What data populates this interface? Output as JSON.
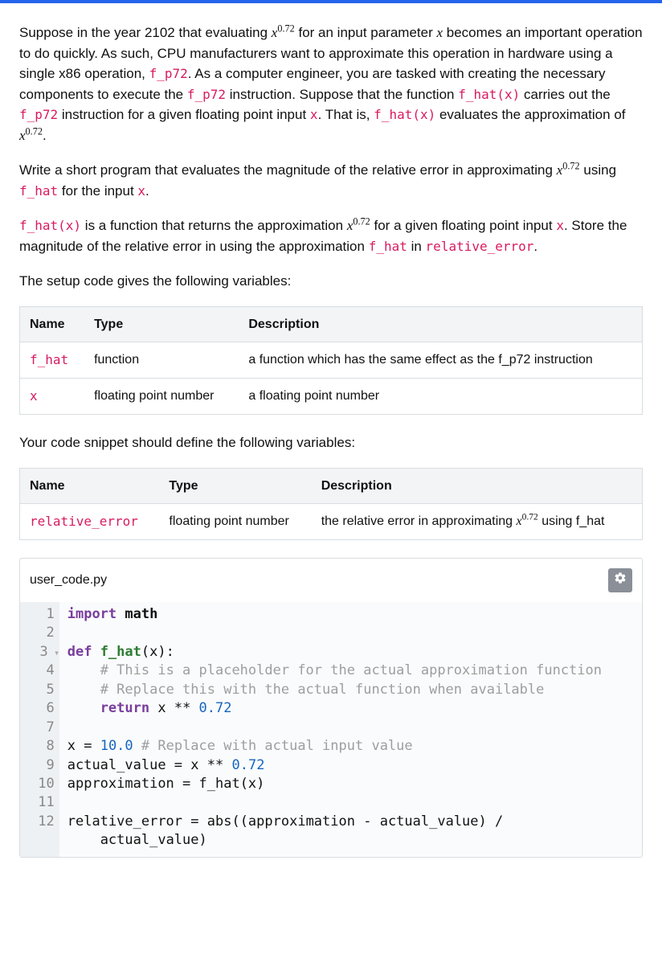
{
  "problem": {
    "p1_a": "Suppose in the year 2102 that evaluating ",
    "p1_exp": "0.72",
    "p1_b": " for an input parameter ",
    "p1_c": " becomes an important operation to do quickly. As such, CPU manufacturers want to approximate this operation in hardware using a single x86 operation, ",
    "code_fp72": "f_p72",
    "p1_d": ". As a computer engineer, you are tasked with creating the necessary components to execute the ",
    "p1_e": " instruction. Suppose that the function ",
    "code_fhat_x": "f_hat(x)",
    "p1_f": " carries out the ",
    "p1_g": " instruction for a given floating point input ",
    "code_x": "x",
    "p1_h": ". That is, ",
    "p1_i": " evaluates the approximation of ",
    "p1_tail": ".",
    "p2_a": "Write a short program that evaluates the magnitude of the relative error in approximating ",
    "p2_b": " using ",
    "code_fhat": "f_hat",
    "p2_c": " for the input ",
    "p3_a": " is a function that returns the approximation ",
    "p3_b": " for a given floating point input ",
    "p3_c": ". Store the magnitude of the relative error in using the approximation ",
    "p3_d": " in ",
    "code_rel_err": "relative_error",
    "setup_intro": "The setup code gives the following variables:",
    "output_intro": "Your code snippet should define the following variables:"
  },
  "table1": {
    "h_name": "Name",
    "h_type": "Type",
    "h_desc": "Description",
    "r1_name": "f_hat",
    "r1_type": "function",
    "r1_desc": "a function which has the same effect as the f_p72 instruction",
    "r2_name": "x",
    "r2_type": "floating point number",
    "r2_desc": "a floating point number"
  },
  "table2": {
    "h_name": "Name",
    "h_type": "Type",
    "h_desc": "Description",
    "r1_name": "relative_error",
    "r1_type": "floating point number",
    "r1_desc_a": "the relative error in approximating ",
    "r1_desc_b": " using f_hat"
  },
  "editor": {
    "filename": "user_code.py",
    "lines": {
      "1": "1",
      "2": "2",
      "3": "3",
      "4": "4",
      "5": "5",
      "6": "6",
      "7": "7",
      "8": "8",
      "9": "9",
      "10": "10",
      "11": "11",
      "12": "12"
    },
    "code": {
      "l1_kw": "import",
      "l1_mod": " math",
      "l3_def": "def",
      "l3_name": " f_hat",
      "l3_paren": "(x):",
      "l4": "    # This is a placeholder for the actual approximation function",
      "l5": "    # Replace this with the actual function when available",
      "l6_ret": "    return",
      "l6_rest_a": " x ",
      "l6_op": "**",
      "l6_num": " 0.72",
      "l8_a": "x ",
      "l8_eq": "=",
      "l8_num": " 10.0 ",
      "l8_com": "# Replace with actual input value",
      "l9_a": "actual_value ",
      "l9_eq": "=",
      "l9_b": " x ",
      "l9_op": "**",
      "l9_num": " 0.72",
      "l10_a": "approximation ",
      "l10_eq": "=",
      "l10_b": " f_hat(x)",
      "l12_a": "relative_error ",
      "l12_eq": "=",
      "l12_b": " abs((approximation ",
      "l12_minus": "-",
      "l12_c": " actual_value) ",
      "l12_div": "/",
      "l12_wrap": "    actual_value)"
    }
  }
}
